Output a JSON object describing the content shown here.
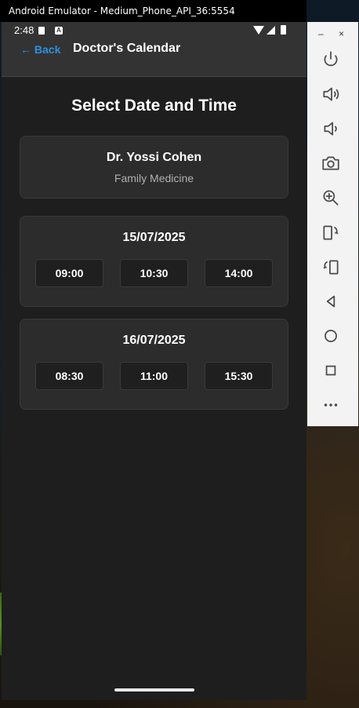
{
  "window": {
    "title": "Android Emulator - Medium_Phone_API_36:5554"
  },
  "status_bar": {
    "time": "2:48",
    "icons": [
      "sd-card-icon",
      "a-icon",
      "wifi-icon",
      "signal-icon",
      "battery-icon"
    ]
  },
  "app_bar": {
    "back_label": "← Back",
    "title": "Doctor's Calendar"
  },
  "page": {
    "heading": "Select Date and Time"
  },
  "doctor": {
    "name": "Dr. Yossi Cohen",
    "specialty": "Family Medicine"
  },
  "dates": [
    {
      "date": "15/07/2025",
      "slots": [
        "09:00",
        "10:30",
        "14:00"
      ]
    },
    {
      "date": "16/07/2025",
      "slots": [
        "08:30",
        "11:00",
        "15:30"
      ]
    }
  ],
  "toolbar": {
    "window_buttons": {
      "minimize": "–",
      "close": "×"
    },
    "buttons": [
      "power-icon",
      "volume-up-icon",
      "volume-down-icon",
      "screenshot-icon",
      "zoom-icon",
      "rotate-left-icon",
      "rotate-right-icon",
      "back-icon",
      "home-icon",
      "overview-icon",
      "more-icon"
    ]
  },
  "colors": {
    "accent": "#2f8fe0",
    "background": "#1e1e1e",
    "card": "#2c2c2c",
    "app_bar": "#333333"
  }
}
